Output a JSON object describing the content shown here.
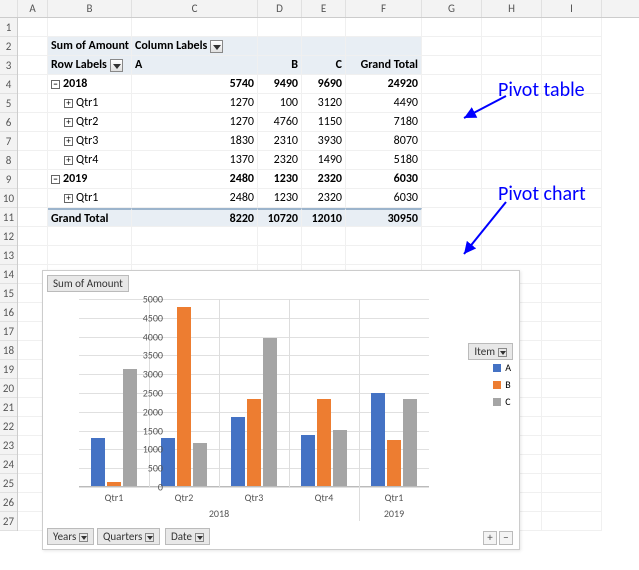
{
  "cols": [
    "A",
    "B",
    "C",
    "D",
    "E",
    "F",
    "G",
    "H",
    "I"
  ],
  "rows": [
    1,
    2,
    3,
    4,
    5,
    6,
    7,
    8,
    9,
    10,
    11,
    12,
    13,
    14,
    15,
    16,
    17,
    18,
    19,
    20,
    21,
    22,
    23,
    24,
    25,
    26,
    27
  ],
  "pivot": {
    "measure": "Sum of Amount",
    "colLabelsHeader": "Column Labels",
    "rowLabelsHeader": "Row Labels",
    "cols": [
      "A",
      "B",
      "C"
    ],
    "grandTotal": "Grand Total",
    "data": [
      {
        "label": "2018",
        "lvl": 0,
        "sign": "−",
        "a": 5740,
        "b": 9490,
        "c": 9690,
        "t": 24920
      },
      {
        "label": "Qtr1",
        "lvl": 1,
        "sign": "+",
        "a": 1270,
        "b": 100,
        "c": 3120,
        "t": 4490
      },
      {
        "label": "Qtr2",
        "lvl": 1,
        "sign": "+",
        "a": 1270,
        "b": 4760,
        "c": 1150,
        "t": 7180
      },
      {
        "label": "Qtr3",
        "lvl": 1,
        "sign": "+",
        "a": 1830,
        "b": 2310,
        "c": 3930,
        "t": 8070
      },
      {
        "label": "Qtr4",
        "lvl": 1,
        "sign": "+",
        "a": 1370,
        "b": 2320,
        "c": 1490,
        "t": 5180
      },
      {
        "label": "2019",
        "lvl": 0,
        "sign": "−",
        "a": 2480,
        "b": 1230,
        "c": 2320,
        "t": 6030
      },
      {
        "label": "Qtr1",
        "lvl": 1,
        "sign": "+",
        "a": 2480,
        "b": 1230,
        "c": 2320,
        "t": 6030
      }
    ],
    "grand": {
      "a": 8220,
      "b": 10720,
      "c": 12010,
      "t": 30950
    }
  },
  "annotations": {
    "table": "Pivot table",
    "chart": "Pivot chart"
  },
  "chartBtns": {
    "measure": "Sum of Amount",
    "legend": "Item",
    "years": "Years",
    "quarters": "Quarters",
    "date": "Date"
  },
  "legend": [
    "A",
    "B",
    "C"
  ],
  "chart_data": {
    "type": "bar",
    "title": "",
    "ylabel": "",
    "ylim": [
      0,
      5000
    ],
    "yticks": [
      0,
      500,
      1000,
      1500,
      2000,
      2500,
      3000,
      3500,
      4000,
      4500,
      5000
    ],
    "outerCategories": [
      "2018",
      "2019"
    ],
    "categories": [
      "Qtr1",
      "Qtr2",
      "Qtr3",
      "Qtr4",
      "Qtr1"
    ],
    "categoryGroupMap": [
      0,
      0,
      0,
      0,
      1
    ],
    "series": [
      {
        "name": "A",
        "values": [
          1270,
          1270,
          1830,
          1370,
          2480
        ],
        "color": "#4472c4"
      },
      {
        "name": "B",
        "values": [
          100,
          4760,
          2310,
          2320,
          1230
        ],
        "color": "#ed7d31"
      },
      {
        "name": "C",
        "values": [
          3120,
          1150,
          3930,
          1490,
          2320
        ],
        "color": "#a5a5a5"
      }
    ]
  }
}
